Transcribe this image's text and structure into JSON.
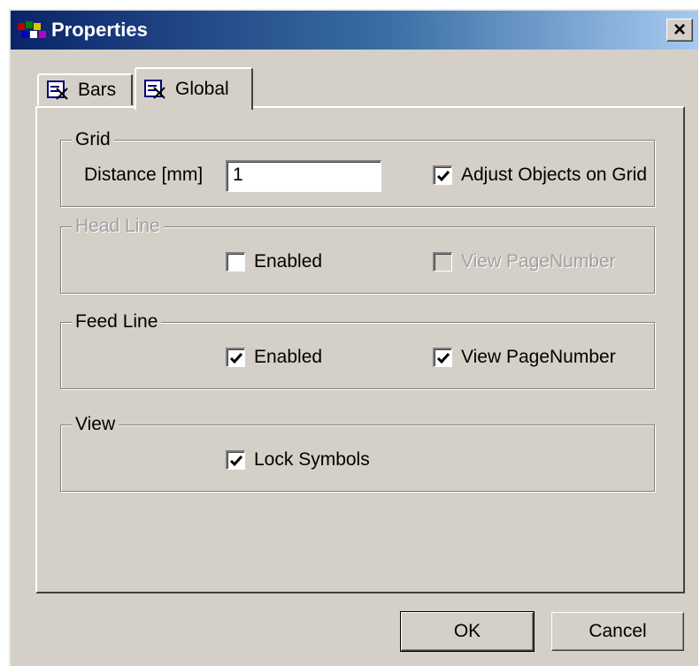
{
  "window": {
    "title": "Properties",
    "close_glyph": "×",
    "app_icon": "app-icon"
  },
  "tabs": [
    {
      "label": "Bars",
      "icon": "property-tab-icon",
      "active": false
    },
    {
      "label": "Global",
      "icon": "property-tab-icon",
      "active": true
    }
  ],
  "grid": {
    "legend": "Grid",
    "distance_label": "Distance [mm]",
    "distance_value": "1",
    "adjust_label": "Adjust Objects on Grid",
    "adjust_checked": true
  },
  "head_line": {
    "legend": "Head Line",
    "disabled": true,
    "enabled_label": "Enabled",
    "enabled_checked": false,
    "view_page_label": "View PageNumber",
    "view_page_checked": false
  },
  "feed_line": {
    "legend": "Feed Line",
    "enabled_label": "Enabled",
    "enabled_checked": true,
    "view_page_label": "View PageNumber",
    "view_page_checked": true
  },
  "view": {
    "legend": "View",
    "lock_label": "Lock Symbols",
    "lock_checked": true
  },
  "buttons": {
    "ok": "OK",
    "cancel": "Cancel"
  },
  "colors": {
    "face": "#d4d0c8",
    "titlebar_start": "#0a246a",
    "titlebar_end": "#a6caf0"
  }
}
